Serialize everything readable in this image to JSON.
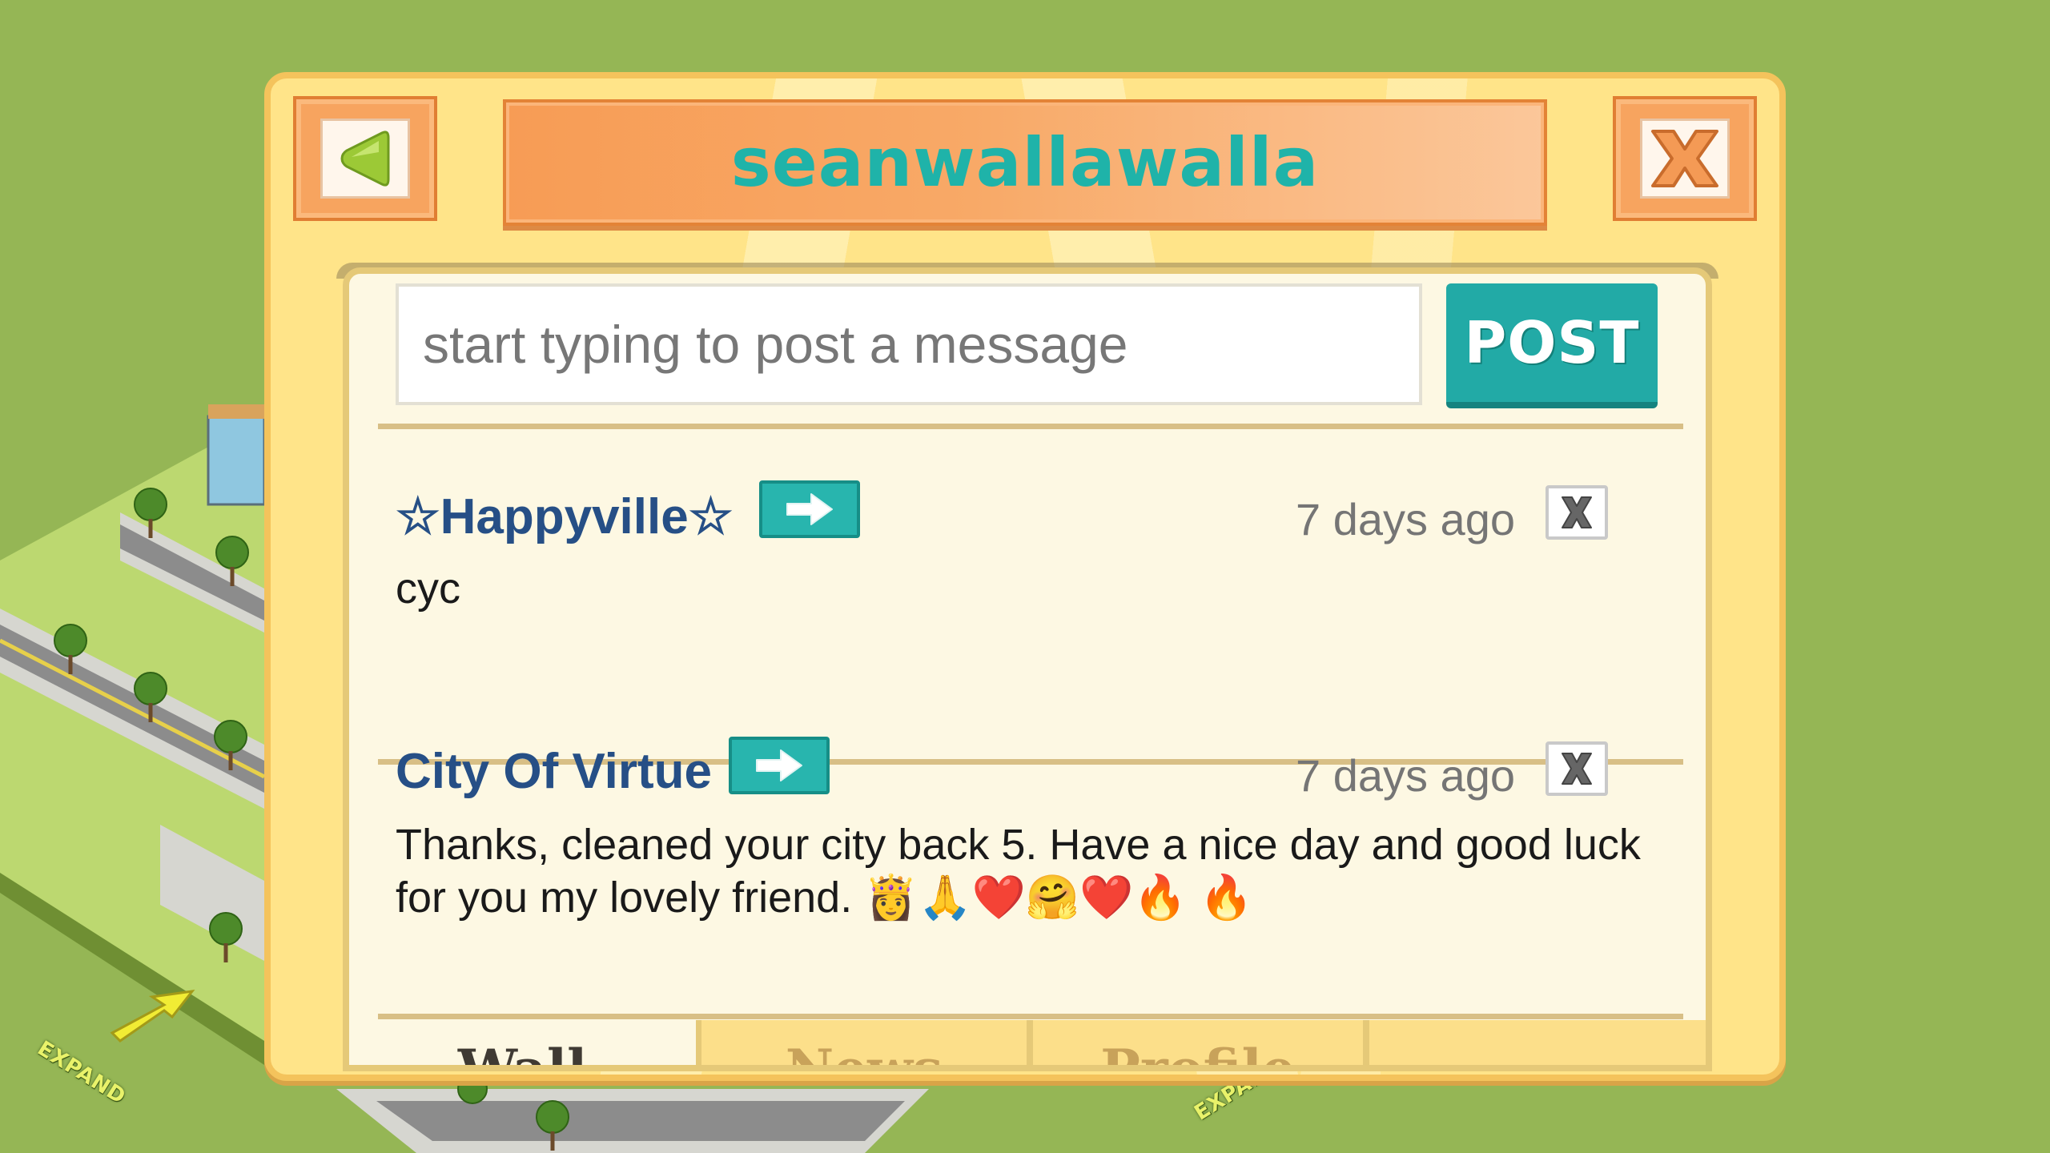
{
  "world": {
    "expand_label": "EXPAND"
  },
  "dialog": {
    "title": "seanwallawalla",
    "back_icon": "triangle-left-icon",
    "close_icon": "x-icon"
  },
  "composer": {
    "placeholder": "start typing to post a message",
    "post_label": "POST"
  },
  "posts": [
    {
      "author": "☆Happyville☆",
      "time": "7 days ago",
      "body": "cyc",
      "delete_label": "X"
    },
    {
      "author": "City Of Virtue",
      "time": "7 days ago",
      "body": "Thanks, cleaned your city back 5. Have a nice day and good luck for you my lovely friend. 👸🙏❤️🤗❤️🔥 🔥",
      "delete_label": "X"
    }
  ],
  "tabs": {
    "wall": "Wall",
    "news": "News",
    "profile": "Profile"
  },
  "colors": {
    "accent_teal": "#22aaa6",
    "title_orange": "#f79c55",
    "author_blue": "#264f86"
  }
}
